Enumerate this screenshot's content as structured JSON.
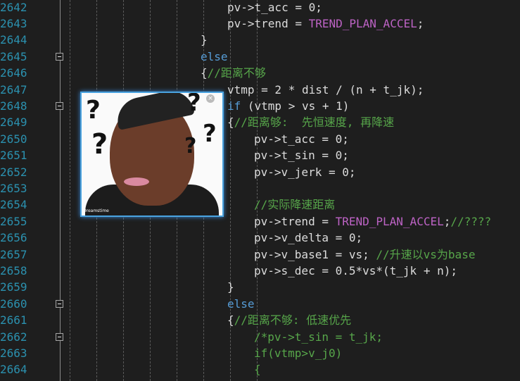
{
  "editor": {
    "lines": [
      {
        "num": "2642",
        "fold": false,
        "tokens": [
          {
            "t": "pv->t_acc = 0;",
            "c": "txt"
          }
        ],
        "indent": 3
      },
      {
        "num": "2643",
        "fold": false,
        "tokens": [
          {
            "t": "pv->trend = ",
            "c": "txt"
          },
          {
            "t": "TREND_PLAN_ACCEL",
            "c": "purple"
          },
          {
            "t": ";",
            "c": "txt"
          }
        ],
        "indent": 3
      },
      {
        "num": "2644",
        "fold": false,
        "tokens": [
          {
            "t": "}",
            "c": "txt"
          }
        ],
        "indent": 2
      },
      {
        "num": "2645",
        "fold": true,
        "tokens": [
          {
            "t": "else",
            "c": "kw"
          }
        ],
        "indent": 2
      },
      {
        "num": "2646",
        "fold": false,
        "tokens": [
          {
            "t": "{",
            "c": "txt"
          },
          {
            "t": "//距离不够",
            "c": "cmt"
          }
        ],
        "indent": 2
      },
      {
        "num": "2647",
        "fold": false,
        "tokens": [
          {
            "t": "vtmp = 2 * dist / (n + t_jk);",
            "c": "txt"
          }
        ],
        "indent": 3
      },
      {
        "num": "2648",
        "fold": true,
        "tokens": [
          {
            "t": "if",
            "c": "kw"
          },
          {
            "t": " (vtmp > vs + 1)",
            "c": "txt"
          }
        ],
        "indent": 3
      },
      {
        "num": "2649",
        "fold": false,
        "tokens": [
          {
            "t": "{",
            "c": "txt"
          },
          {
            "t": "//距离够:  先恒速度, 再降速",
            "c": "cmt"
          }
        ],
        "indent": 3
      },
      {
        "num": "2650",
        "fold": false,
        "tokens": [
          {
            "t": "pv->t_acc = 0;",
            "c": "txt"
          }
        ],
        "indent": 4
      },
      {
        "num": "2651",
        "fold": false,
        "tokens": [
          {
            "t": "pv->t_sin = 0;",
            "c": "txt"
          }
        ],
        "indent": 4
      },
      {
        "num": "2652",
        "fold": false,
        "tokens": [
          {
            "t": "pv->v_jerk = 0;",
            "c": "txt"
          }
        ],
        "indent": 4
      },
      {
        "num": "2653",
        "fold": false,
        "tokens": [],
        "indent": 4
      },
      {
        "num": "2654",
        "fold": false,
        "tokens": [
          {
            "t": "//实际降速距离",
            "c": "cmt"
          }
        ],
        "indent": 4
      },
      {
        "num": "2655",
        "fold": false,
        "tokens": [
          {
            "t": "pv->trend = ",
            "c": "txt"
          },
          {
            "t": "TREND_PLAN_ACCEL",
            "c": "purple"
          },
          {
            "t": ";",
            "c": "txt"
          },
          {
            "t": "//????",
            "c": "cmt"
          }
        ],
        "indent": 4
      },
      {
        "num": "2656",
        "fold": false,
        "tokens": [
          {
            "t": "pv->v_delta = 0;",
            "c": "txt"
          }
        ],
        "indent": 4
      },
      {
        "num": "2657",
        "fold": false,
        "tokens": [
          {
            "t": "pv->v_base1 = vs; ",
            "c": "txt"
          },
          {
            "t": "//升速以vs为base",
            "c": "cmt"
          }
        ],
        "indent": 4
      },
      {
        "num": "2658",
        "fold": false,
        "tokens": [
          {
            "t": "pv->s_dec = 0.5*vs*(t_jk + n);",
            "c": "txt"
          }
        ],
        "indent": 4
      },
      {
        "num": "2659",
        "fold": false,
        "tokens": [
          {
            "t": "}",
            "c": "txt"
          }
        ],
        "indent": 3
      },
      {
        "num": "2660",
        "fold": true,
        "tokens": [
          {
            "t": "else",
            "c": "kw"
          }
        ],
        "indent": 3
      },
      {
        "num": "2661",
        "fold": false,
        "tokens": [
          {
            "t": "{",
            "c": "txt"
          },
          {
            "t": "//距离不够: 低速优先",
            "c": "cmt"
          }
        ],
        "indent": 3
      },
      {
        "num": "2662",
        "fold": true,
        "tokens": [
          {
            "t": "/*pv->t_sin = t_jk;",
            "c": "cmt"
          }
        ],
        "indent": 4
      },
      {
        "num": "2663",
        "fold": false,
        "tokens": [
          {
            "t": "if(vtmp>v_j0)",
            "c": "cmt"
          }
        ],
        "indent": 4
      },
      {
        "num": "2664",
        "fold": false,
        "tokens": [
          {
            "t": "{",
            "c": "cmt"
          }
        ],
        "indent": 4
      }
    ]
  },
  "overlay": {
    "marks": [
      "?",
      "?",
      "?",
      "?",
      "?"
    ],
    "close_glyph": "×",
    "credit": "Dreamstime"
  }
}
